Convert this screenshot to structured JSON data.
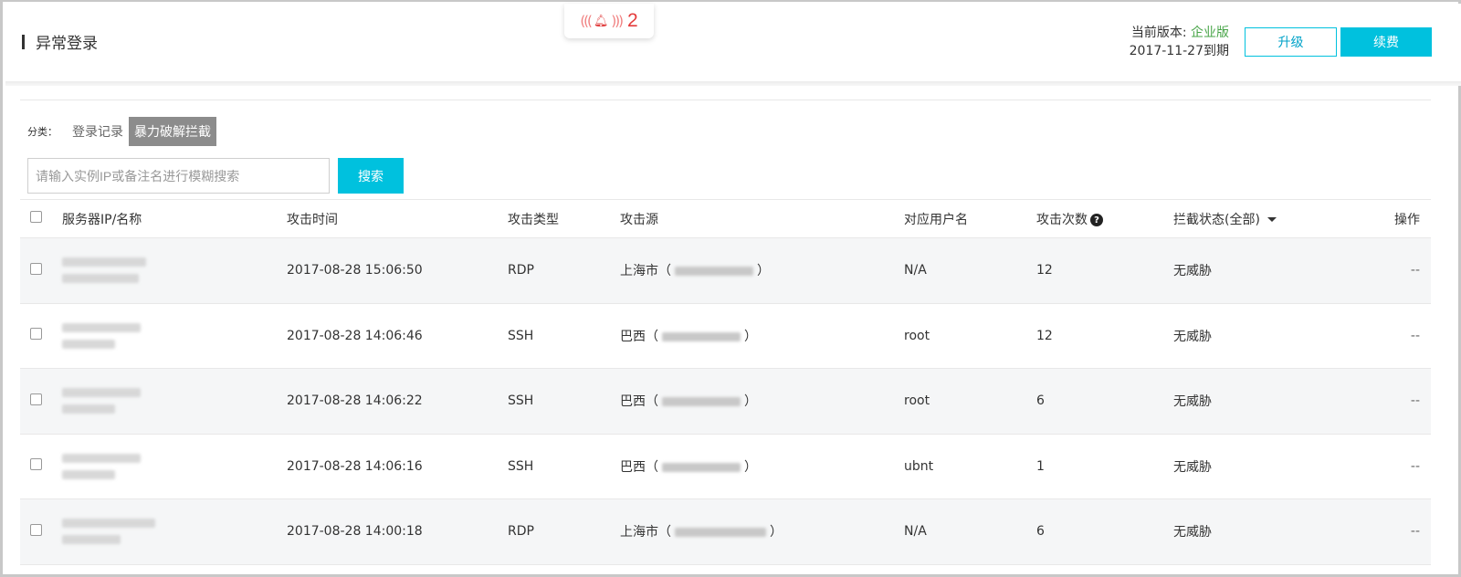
{
  "header": {
    "title": "异常登录",
    "notification_count": "2",
    "version_label": "当前版本: ",
    "edition": "企业版",
    "expiry": "2017-11-27到期",
    "upgrade_label": "升级",
    "renew_label": "续费"
  },
  "filters": {
    "category_label": "分类：",
    "tabs": [
      "登录记录",
      "暴力破解拦截"
    ],
    "active_tab": "暴力破解拦截",
    "search_placeholder": "请输入实例IP或备注名进行模糊搜索",
    "search_button": "搜索"
  },
  "table": {
    "columns": {
      "ip": "服务器IP/名称",
      "time": "攻击时间",
      "type": "攻击类型",
      "source": "攻击源",
      "user": "对应用户名",
      "count": "攻击次数",
      "status": "拦截状态(全部)",
      "op": "操作"
    },
    "rows": [
      {
        "time": "2017-08-28 15:06:50",
        "type": "RDP",
        "source_city": "上海市",
        "user": "N/A",
        "count": "12",
        "status": "无威胁",
        "op": "--"
      },
      {
        "time": "2017-08-28 14:06:46",
        "type": "SSH",
        "source_city": "巴西",
        "user": "root",
        "count": "12",
        "status": "无威胁",
        "op": "--"
      },
      {
        "time": "2017-08-28 14:06:22",
        "type": "SSH",
        "source_city": "巴西",
        "user": "root",
        "count": "6",
        "status": "无威胁",
        "op": "--"
      },
      {
        "time": "2017-08-28 14:06:16",
        "type": "SSH",
        "source_city": "巴西",
        "user": "ubnt",
        "count": "1",
        "status": "无威胁",
        "op": "--"
      },
      {
        "time": "2017-08-28 14:00:18",
        "type": "RDP",
        "source_city": "上海市",
        "user": "N/A",
        "count": "6",
        "status": "无威胁",
        "op": "--"
      }
    ]
  },
  "colors": {
    "accent": "#00c1de",
    "edition_green": "#48a548",
    "alert_red": "#e43c3c"
  },
  "icons": [
    "bell-icon",
    "help-icon",
    "caret-down-icon"
  ]
}
